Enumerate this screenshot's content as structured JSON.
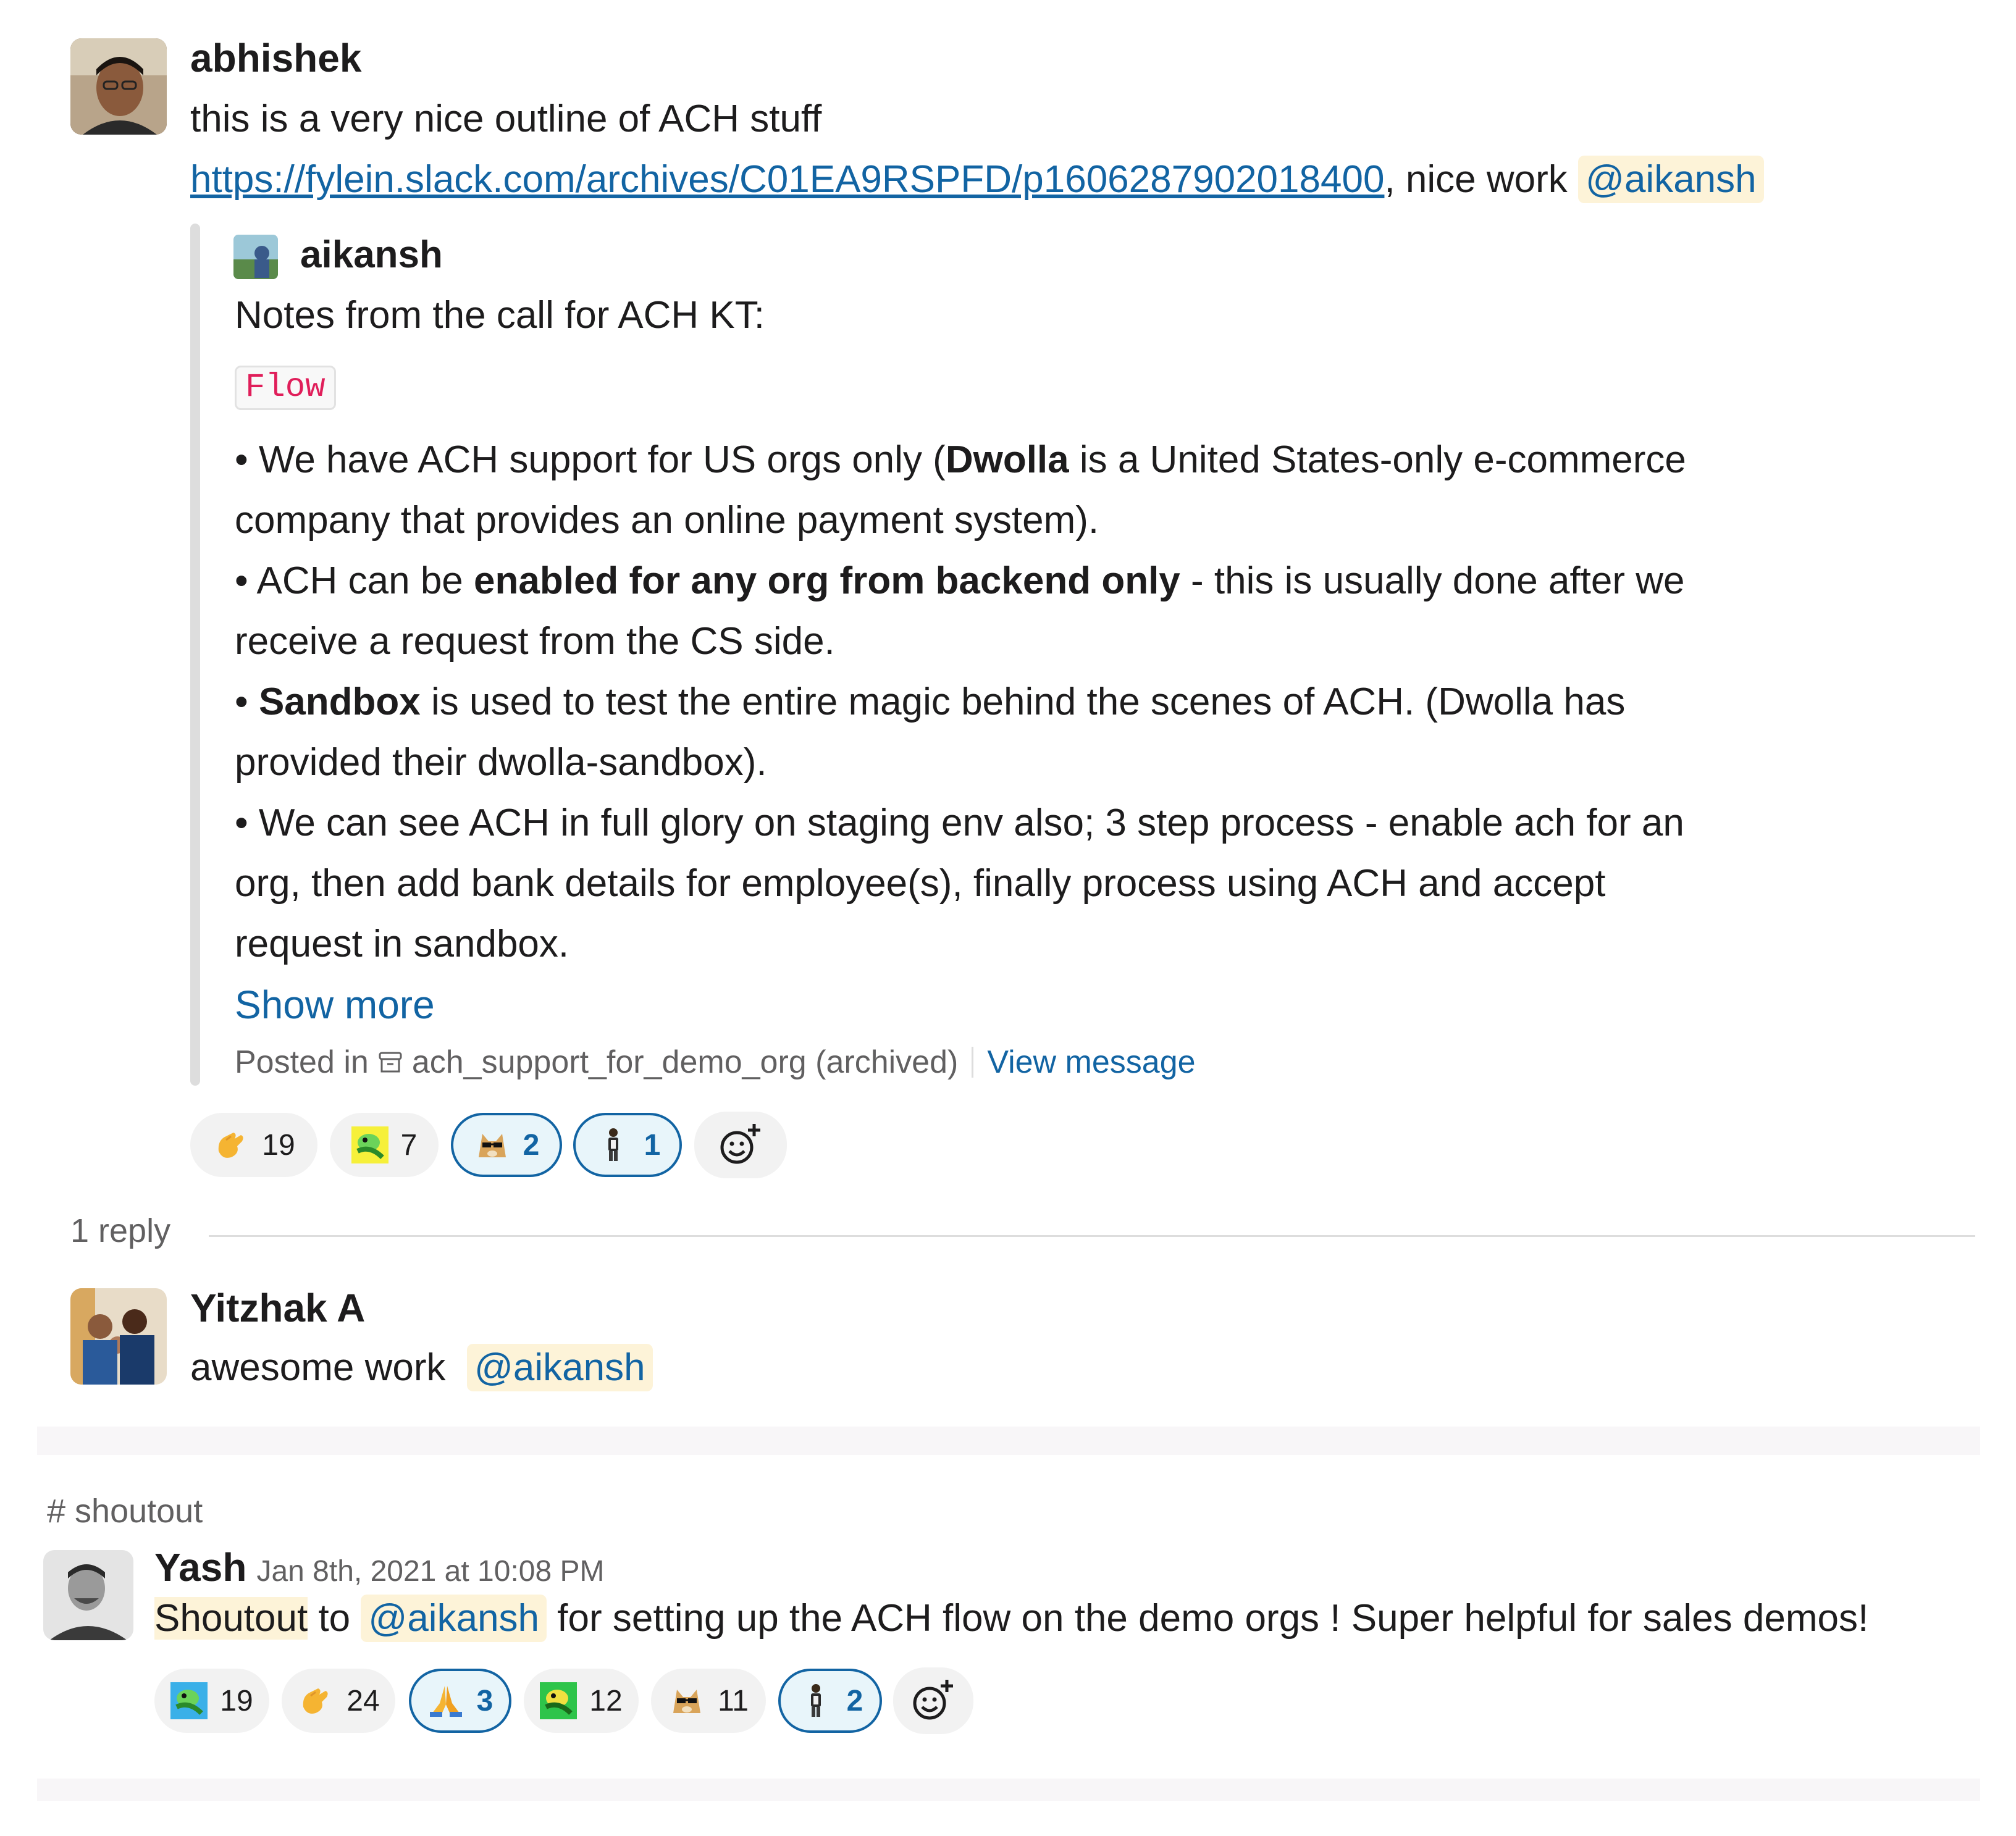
{
  "message1": {
    "author": "abhishek",
    "line1": "this is a very nice outline of ACH stuff",
    "link": "https://fylein.slack.com/archives/C01EA9RSPFD/p1606287902018400",
    "after_link": ", nice work ",
    "mention": "@aikansh",
    "attachment": {
      "author": "aikansh",
      "intro": "Notes from the call for ACH KT:",
      "code": "Flow",
      "b1_pre": "• We have ACH support for US orgs only (",
      "b1_bold": "Dwolla",
      "b1_post": " is a United States-only e-commerce",
      "b1_line2": "company that provides an online payment system).",
      "b2_pre": "• ACH can be ",
      "b2_bold": "enabled for any org from backend only",
      "b2_post": " - this is usually done after we",
      "b2_line2": "receive a request from the CS side.",
      "b3_pre": "• ",
      "b3_bold": "Sandbox",
      "b3_post": " is used to test the entire magic behind the scenes of ACH. (Dwolla has",
      "b3_line2": "provided their dwolla-sandbox).",
      "b4_line1": "• We can see ACH in full glory on staging env also; 3 step process - enable ach for an",
      "b4_line2": "org, then add bank details for employee(s), finally process using ACH and accept",
      "b4_line3": "request in sandbox.",
      "show_more": "Show more",
      "posted_in": "Posted in",
      "channel": "ach_support_for_demo_org (archived)",
      "view_message": "View message"
    },
    "reactions": [
      {
        "emoji": "clap-icon",
        "count": "19",
        "active": false
      },
      {
        "emoji": "party-parrot-icon",
        "count": "7",
        "active": false
      },
      {
        "emoji": "doge-sunglasses-icon",
        "count": "2",
        "active": true
      },
      {
        "emoji": "person-standing-icon",
        "count": "1",
        "active": true
      }
    ]
  },
  "thread": {
    "reply_count": "1 reply",
    "reply": {
      "author": "Yitzhak A",
      "text": "awesome work",
      "mention": "@aikansh"
    }
  },
  "message2": {
    "channel": "shoutout",
    "author": "Yash",
    "timestamp": "Jan 8th, 2021 at 10:08 PM",
    "word1": "Shoutout",
    "to": " to ",
    "mention": "@aikansh",
    "rest": " for setting up the ACH flow on the demo orgs ! Super helpful for sales demos!",
    "reactions": [
      {
        "emoji": "party-parrot-blue-icon",
        "count": "19",
        "active": false
      },
      {
        "emoji": "clap-icon",
        "count": "24",
        "active": false
      },
      {
        "emoji": "pray-icon",
        "count": "3",
        "active": true
      },
      {
        "emoji": "party-parrot-green-icon",
        "count": "12",
        "active": false
      },
      {
        "emoji": "doge-sunglasses-icon",
        "count": "11",
        "active": false
      },
      {
        "emoji": "person-standing-icon",
        "count": "2",
        "active": true
      }
    ]
  },
  "colors": {
    "link": "#1264a3",
    "mention_bg": "#fdf3d8",
    "code_text": "#e01e5a"
  }
}
